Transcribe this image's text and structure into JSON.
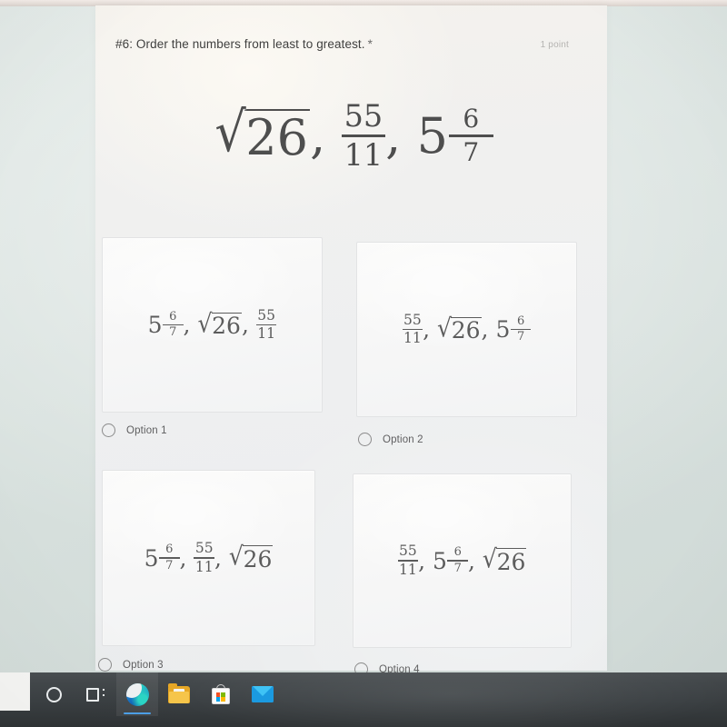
{
  "question": {
    "title": "#6: Order the numbers from least to greatest.",
    "required_marker": "*",
    "points": "1 point"
  },
  "prompt": {
    "term1": {
      "type": "radical",
      "radicand": "26"
    },
    "separator1": ",",
    "term2": {
      "type": "fraction",
      "numerator": "55",
      "denominator": "11"
    },
    "separator2": ",",
    "term3": {
      "type": "mixed",
      "whole": "5",
      "numerator": "6",
      "denominator": "7"
    }
  },
  "options": [
    {
      "id": "option-1",
      "label": "Option 1",
      "selected": false,
      "terms": [
        {
          "type": "mixed",
          "whole": "5",
          "numerator": "6",
          "denominator": "7"
        },
        {
          "type": "radical",
          "radicand": "26"
        },
        {
          "type": "fraction",
          "numerator": "55",
          "denominator": "11"
        }
      ],
      "separator": ","
    },
    {
      "id": "option-2",
      "label": "Option 2",
      "selected": false,
      "terms": [
        {
          "type": "fraction",
          "numerator": "55",
          "denominator": "11"
        },
        {
          "type": "radical",
          "radicand": "26"
        },
        {
          "type": "mixed",
          "whole": "5",
          "numerator": "6",
          "denominator": "7"
        }
      ],
      "separator": ","
    },
    {
      "id": "option-3",
      "label": "Option 3",
      "selected": false,
      "terms": [
        {
          "type": "mixed",
          "whole": "5",
          "numerator": "6",
          "denominator": "7"
        },
        {
          "type": "fraction",
          "numerator": "55",
          "denominator": "11"
        },
        {
          "type": "radical",
          "radicand": "26"
        }
      ],
      "separator": ","
    },
    {
      "id": "option-4",
      "label": "Option 4",
      "selected": false,
      "terms": [
        {
          "type": "fraction",
          "numerator": "55",
          "denominator": "11"
        },
        {
          "type": "mixed",
          "whole": "5",
          "numerator": "6",
          "denominator": "7"
        },
        {
          "type": "radical",
          "radicand": "26"
        }
      ],
      "separator": ","
    }
  ],
  "taskbar": {
    "items": [
      {
        "icon": "cortana-circle-icon",
        "active": false
      },
      {
        "icon": "task-view-icon",
        "active": false
      },
      {
        "icon": "microsoft-edge-icon",
        "active": true
      },
      {
        "icon": "file-explorer-icon",
        "active": false
      },
      {
        "icon": "microsoft-store-icon",
        "active": false
      },
      {
        "icon": "mail-icon",
        "active": false
      }
    ],
    "active_accent": "#4da0e8"
  },
  "colors": {
    "card_background": "#f1f0ee",
    "screen_background": "#dde5e2",
    "text_primary": "#40403f",
    "text_muted": "#b4b3b0",
    "math_ink": "#4e4e4e",
    "taskbar": "#3b4043"
  },
  "symbols": {
    "radical_sign": "√"
  }
}
